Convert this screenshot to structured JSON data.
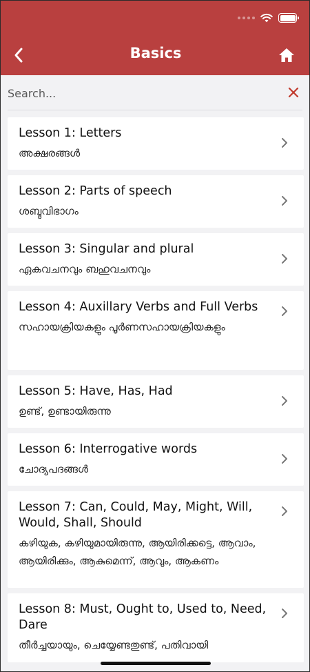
{
  "header": {
    "title": "Basics",
    "back_icon": "chevron-left-icon",
    "home_icon": "home-icon"
  },
  "search": {
    "placeholder": "Search...",
    "value": "",
    "clear_icon": "close-icon"
  },
  "colors": {
    "header_bg": "#b9403f",
    "accent_red": "#c0392b",
    "page_bg": "#f2f2f4"
  },
  "lessons": [
    {
      "title": "Lesson 1: Letters",
      "subtitle": "അക്ഷരങ്ങൾ"
    },
    {
      "title": "Lesson 2: Parts of speech",
      "subtitle": "ശബ്ദവിഭാഗം"
    },
    {
      "title": "Lesson 3: Singular and plural",
      "subtitle": "ഏകവചനവും ബഹുവചനവും"
    },
    {
      "title": "Lesson 4: Auxillary Verbs and Full Verbs",
      "subtitle": "സഹായക്രിയകളും പൂർണസഹായക്രിയകളും"
    },
    {
      "title": "Lesson 5: Have, Has, Had",
      "subtitle": "ഉണ്ട്, ഉണ്ടായിരുന്നു"
    },
    {
      "title": "Lesson 6: Interrogative words",
      "subtitle": "ചോദ്യപദങ്ങൾ"
    },
    {
      "title": "Lesson 7: Can, Could, May, Might, Will, Would, Shall, Should",
      "subtitle": "കഴിയുക, കഴിയുമായിരുന്നു, ആയിരിക്കട്ടെ, ആവാം, ആയിരിക്കും, ആകുമെന്ന്, ആവും, ആകണം"
    },
    {
      "title": "Lesson 8: Must, Ought to, Used to, Need, Dare",
      "subtitle": "തീർച്ചയായും, ചെയ്യേണ്ടതുണ്ട്, പതിവായി"
    }
  ]
}
